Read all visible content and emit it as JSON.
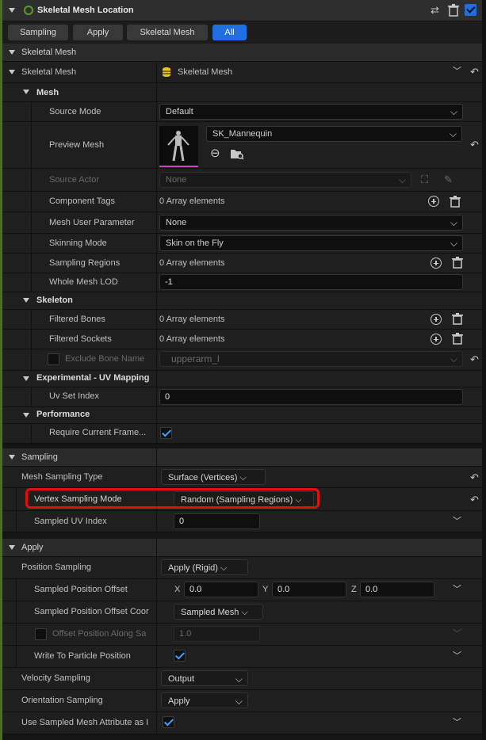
{
  "header": {
    "title": "Skeletal Mesh Location"
  },
  "filters": [
    "Sampling",
    "Apply",
    "Skeletal Mesh",
    "All"
  ],
  "active_filter": "All",
  "sections": {
    "skeletal_mesh": "Skeletal Mesh",
    "sampling": "Sampling",
    "apply": "Apply"
  },
  "skeletal_mesh": {
    "label": "Skeletal Mesh",
    "value": "Skeletal Mesh",
    "mesh_group": "Mesh",
    "source_mode": {
      "label": "Source Mode",
      "value": "Default"
    },
    "preview_mesh": {
      "label": "Preview Mesh",
      "value": "SK_Mannequin"
    },
    "source_actor": {
      "label": "Source Actor",
      "value": "None"
    },
    "component_tags": {
      "label": "Component Tags",
      "value": "0 Array elements"
    },
    "mesh_user_parameter": {
      "label": "Mesh User Parameter",
      "value": "None"
    },
    "skinning_mode": {
      "label": "Skinning Mode",
      "value": "Skin on the Fly"
    },
    "sampling_regions": {
      "label": "Sampling Regions",
      "value": "0 Array elements"
    },
    "whole_mesh_lod": {
      "label": "Whole Mesh LOD",
      "value": "-1"
    },
    "skeleton_group": "Skeleton",
    "filtered_bones": {
      "label": "Filtered Bones",
      "value": "0 Array elements"
    },
    "filtered_sockets": {
      "label": "Filtered Sockets",
      "value": "0 Array elements"
    },
    "exclude_bone_name": {
      "label": "Exclude Bone Name",
      "value": "upperarm_l"
    },
    "uv_group": "Experimental - UV Mapping",
    "uv_set_index": {
      "label": "Uv Set Index",
      "value": "0"
    },
    "performance_group": "Performance",
    "require_current_frame": {
      "label": "Require Current Frame...",
      "checked": true
    }
  },
  "sampling": {
    "mesh_sampling_type": {
      "label": "Mesh Sampling Type",
      "value": "Surface (Vertices)"
    },
    "vertex_sampling_mode": {
      "label": "Vertex Sampling Mode",
      "value": "Random (Sampling Regions)"
    },
    "sampled_uv_index": {
      "label": "Sampled UV Index",
      "value": "0"
    }
  },
  "apply": {
    "position_sampling": {
      "label": "Position Sampling",
      "value": "Apply (Rigid)"
    },
    "sampled_position_offset": {
      "label": "Sampled Position Offset",
      "x_label": "X",
      "x": "0.0",
      "y_label": "Y",
      "y": "0.0",
      "z_label": "Z",
      "z": "0.0"
    },
    "sampled_position_offset_coord": {
      "label": "Sampled Position Offset Coor",
      "value": "Sampled Mesh"
    },
    "offset_position_along": {
      "label": "Offset Position Along Sa",
      "value": "1.0"
    },
    "write_to_particle_position": {
      "label": "Write To Particle Position",
      "checked": true
    },
    "velocity_sampling": {
      "label": "Velocity Sampling",
      "value": "Output"
    },
    "orientation_sampling": {
      "label": "Orientation Sampling",
      "value": "Apply"
    },
    "use_sampled_mesh_attribute": {
      "label": "Use Sampled Mesh Attribute as I",
      "checked": true
    }
  },
  "colors": {
    "highlight": "#e01010",
    "accent": "#1f6fe0",
    "check": "#3aa0ff",
    "left_bar": "#4e6b2e"
  }
}
